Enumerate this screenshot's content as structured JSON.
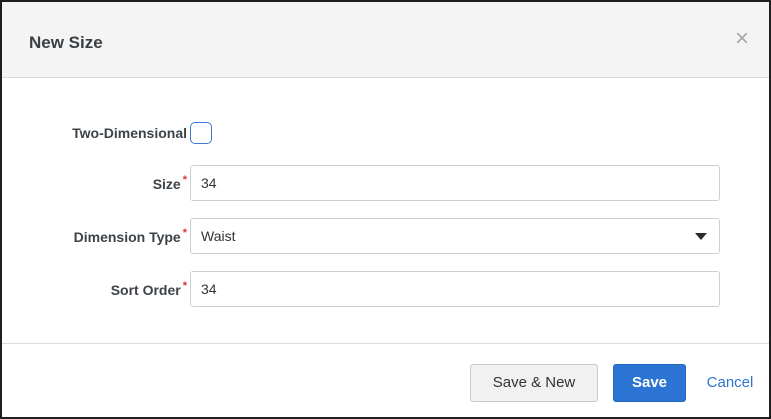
{
  "dialog": {
    "title": "New Size",
    "close_icon": "close-icon"
  },
  "form": {
    "two_dimensional": {
      "label": "Two-Dimensional",
      "checked": false
    },
    "size": {
      "label": "Size",
      "required_marker": "*",
      "value": "34"
    },
    "dimension_type": {
      "label": "Dimension Type",
      "required_marker": "*",
      "value": "Waist",
      "icon": "caret-down-icon"
    },
    "sort_order": {
      "label": "Sort Order",
      "required_marker": "*",
      "value": "34"
    }
  },
  "footer": {
    "save_new_label": "Save & New",
    "save_label": "Save",
    "cancel_label": "Cancel"
  },
  "colors": {
    "primary": "#2b74d4",
    "link": "#2f73cf",
    "required": "#e2332d",
    "header_bg": "#f4f4f4"
  }
}
